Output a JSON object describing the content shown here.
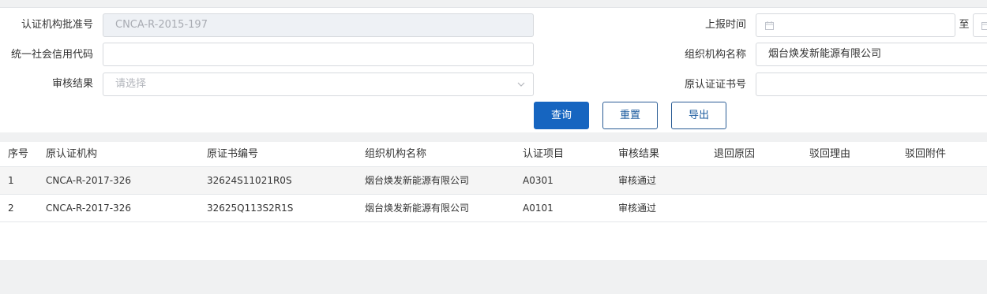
{
  "form": {
    "approval_no": {
      "label": "认证机构批准号",
      "value": "CNCA-R-2015-197"
    },
    "report_time": {
      "label": "上报时间",
      "separator": "至"
    },
    "credit_code": {
      "label": "统一社会信用代码",
      "value": ""
    },
    "org_name": {
      "label": "组织机构名称",
      "value": "烟台焕发新能源有限公司"
    },
    "review_result": {
      "label": "审核结果",
      "placeholder": "请选择"
    },
    "orig_cert_no": {
      "label": "原认证证书号",
      "value": ""
    }
  },
  "buttons": {
    "query": "查询",
    "reset": "重置",
    "export": "导出"
  },
  "table": {
    "headers": [
      "序号",
      "原认证机构",
      "原证书编号",
      "组织机构名称",
      "认证项目",
      "审核结果",
      "退回原因",
      "驳回理由",
      "驳回附件"
    ],
    "rows": [
      [
        "1",
        "CNCA-R-2017-326",
        "32624S11021R0S",
        "烟台焕发新能源有限公司",
        "A0301",
        "审核通过",
        "",
        "",
        ""
      ],
      [
        "2",
        "CNCA-R-2017-326",
        "32625Q113S2R1S",
        "烟台焕发新能源有限公司",
        "A0101",
        "审核通过",
        "",
        "",
        ""
      ]
    ]
  },
  "icons": {
    "calendar": "calendar-icon",
    "chevron": "chevron-down-icon"
  }
}
